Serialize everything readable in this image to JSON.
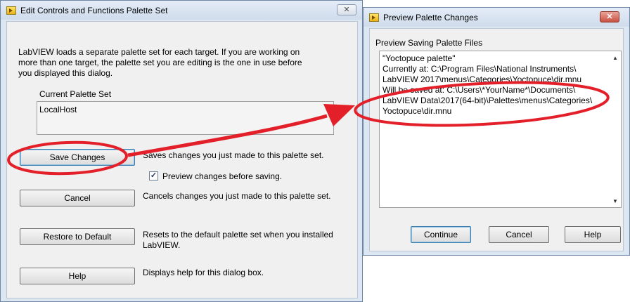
{
  "left_dialog": {
    "title": "Edit Controls and Functions Palette Set",
    "close_label": "✕",
    "intro_lines": [
      "LabVIEW loads a separate palette set for each target. If you are working on",
      "more than one target, the palette set you are editing is the one in use before",
      "you displayed this dialog."
    ],
    "current_set_label": "Current Palette Set",
    "current_set_value": "LocalHost",
    "save_button": "Save Changes",
    "save_desc": "Saves changes you just made to this palette set.",
    "preview_checkbox_label": "Preview changes before saving.",
    "preview_checked": true,
    "cancel_button": "Cancel",
    "cancel_desc": "Cancels changes you just made to this palette set.",
    "restore_button": "Restore to Default",
    "restore_desc_lines": [
      "Resets to the default palette set when you installed",
      "LabVIEW."
    ],
    "help_button": "Help",
    "help_desc": "Displays help for this dialog box."
  },
  "right_dialog": {
    "title": "Preview Palette Changes",
    "close_label": "✕",
    "section_label": "Preview Saving Palette Files",
    "text_lines": [
      "\"Yoctopuce palette\"",
      "Currently at: C:\\Program Files\\National Instruments\\",
      "LabVIEW 2017\\menus\\Categories\\Yoctopuce\\dir.mnu",
      "Will be saved at: C:\\Users\\*YourName*\\Documents\\",
      "LabVIEW Data\\2017(64-bit)\\Palettes\\menus\\Categories\\",
      "Yoctopuce\\dir.mnu"
    ],
    "continue_button": "Continue",
    "cancel_button": "Cancel",
    "help_button": "Help"
  },
  "annotation": {
    "color": "#e3202a"
  },
  "icons": {
    "app": "labview-app-icon",
    "close": "close-icon",
    "check": "checkmark-icon",
    "scroll_up": "scroll-up-arrow-icon",
    "scroll_down": "scroll-down-arrow-icon"
  }
}
